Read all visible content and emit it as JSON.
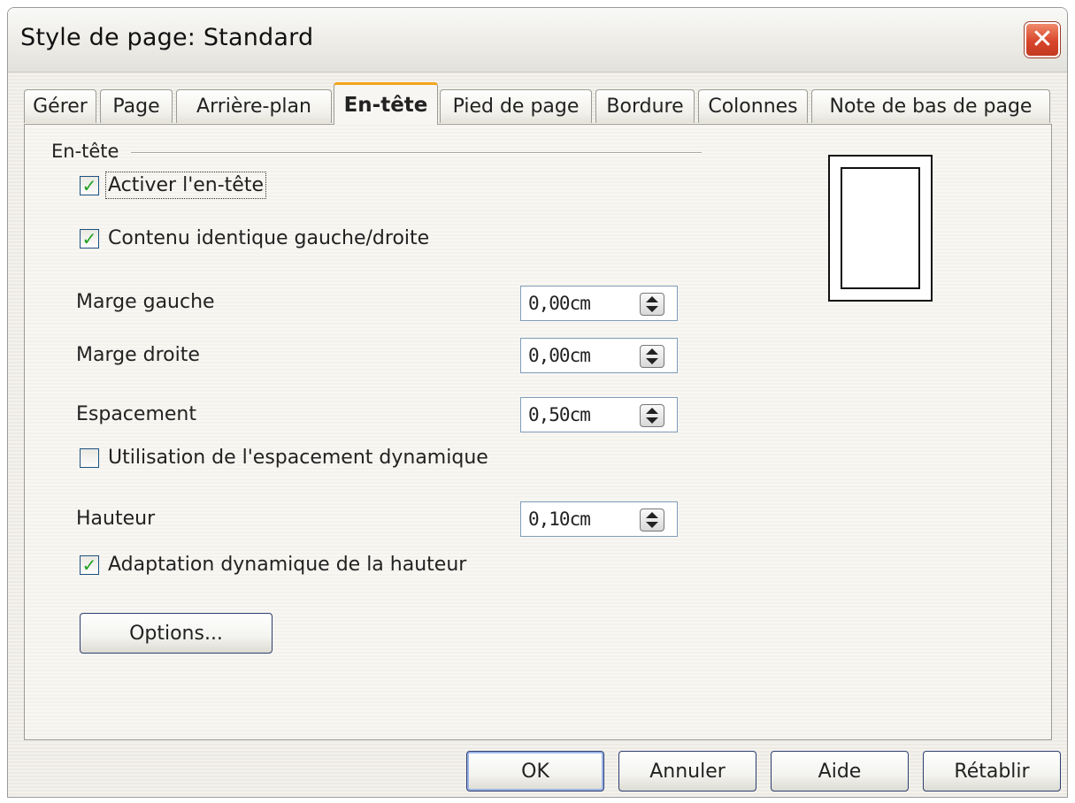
{
  "window": {
    "title": "Style de page: Standard",
    "close_icon": "close-icon",
    "close_glyph": "✕"
  },
  "tabs": [
    {
      "label": "Gérer",
      "active": false
    },
    {
      "label": "Page",
      "active": false
    },
    {
      "label": "Arrière-plan",
      "active": false
    },
    {
      "label": "En-tête",
      "active": true
    },
    {
      "label": "Pied de page",
      "active": false
    },
    {
      "label": "Bordure",
      "active": false
    },
    {
      "label": "Colonnes",
      "active": false
    },
    {
      "label": "Note de bas de page",
      "active": false
    }
  ],
  "header_group": {
    "label": "En-tête",
    "activate": {
      "label": "Activer l'en-tête",
      "checked": true,
      "check_glyph": "✓"
    },
    "same_content": {
      "label": "Contenu identique gauche/droite",
      "checked": true,
      "check_glyph": "✓"
    },
    "left_margin": {
      "label": "Marge gauche",
      "value": "0,00cm"
    },
    "right_margin": {
      "label": "Marge droite",
      "value": "0,00cm"
    },
    "spacing": {
      "label": "Espacement",
      "value": "0,50cm"
    },
    "dynamic_spacing": {
      "label": "Utilisation de l'espacement dynamique",
      "checked": false,
      "check_glyph": ""
    },
    "height": {
      "label": "Hauteur",
      "value": "0,10cm"
    },
    "autofit_height": {
      "label": "Adaptation dynamique de la hauteur",
      "checked": true,
      "check_glyph": "✓"
    },
    "options_button": "Options..."
  },
  "buttons": {
    "ok": "OK",
    "cancel": "Annuler",
    "help": "Aide",
    "reset": "Rétablir"
  },
  "colors": {
    "active_tab_accent": "#f2a51c",
    "close_button": "#d8452a",
    "checkmark": "#21a121"
  }
}
